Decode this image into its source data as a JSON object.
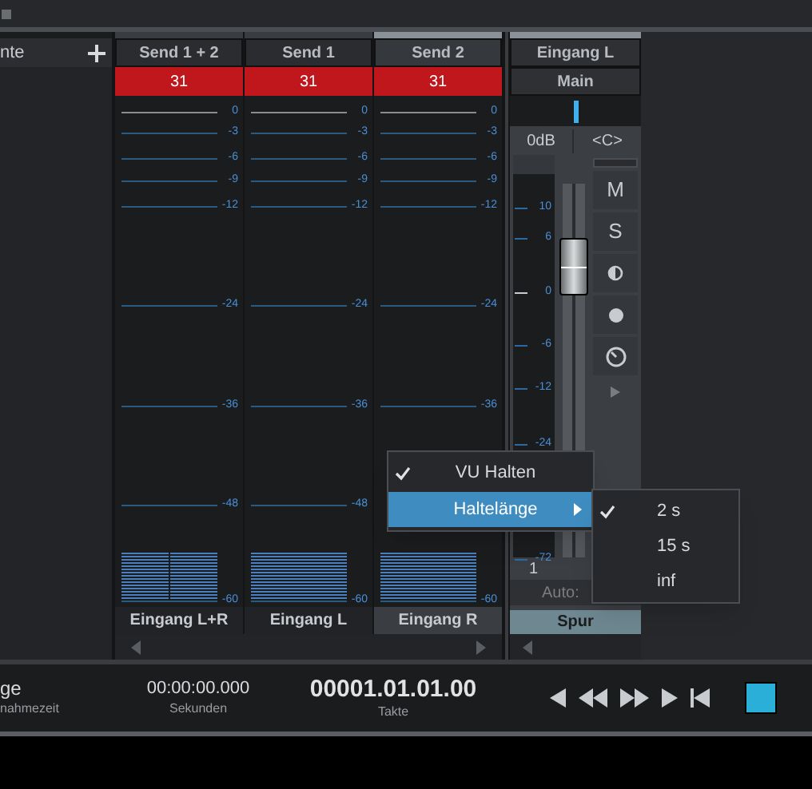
{
  "sidebar": {
    "title": "nte"
  },
  "sends": [
    {
      "name": "Send 1 + 2",
      "value": "31",
      "selected": false,
      "kind": "stereo",
      "scale": [
        "0",
        "-3",
        "-6",
        "-9",
        "-12",
        "-24",
        "-36",
        "-48",
        "-60"
      ],
      "footer": "Eingang L+R"
    },
    {
      "name": "Send 1",
      "value": "31",
      "selected": false,
      "kind": "mono",
      "scale": [
        "0",
        "-3",
        "-6",
        "-9",
        "-12",
        "-24",
        "-36",
        "-48",
        "-60"
      ],
      "footer": "Eingang L"
    },
    {
      "name": "Send 2",
      "value": "31",
      "selected": true,
      "kind": "mono",
      "scale": [
        "0",
        "-3",
        "-6",
        "-9",
        "-12",
        "-24",
        "-36",
        "-60"
      ],
      "footer": "Eingang R"
    }
  ],
  "channel": {
    "name": "Eingang L",
    "output": "Main",
    "volume": "0dB",
    "pan": "<C>",
    "scale": [
      "10",
      "6",
      "0",
      "-6",
      "-12",
      "-24",
      "-72"
    ],
    "buttons": [
      "M",
      "S"
    ],
    "number": "1",
    "automation": "Auto:",
    "footer": "Spur"
  },
  "context_menu": {
    "items": [
      {
        "label": "VU Halten",
        "checked": true,
        "selected": false,
        "submenu": false
      },
      {
        "label": "Haltelänge",
        "checked": false,
        "selected": true,
        "submenu": true
      }
    ]
  },
  "submenu": {
    "items": [
      {
        "label": "2 s",
        "checked": true
      },
      {
        "label": "15 s",
        "checked": false
      },
      {
        "label": "inf",
        "checked": false
      }
    ]
  },
  "transport": {
    "record_time": {
      "value": "ge",
      "label": "nahmezeit"
    },
    "seconds": {
      "value": "00:00:00.000",
      "label": "Sekunden"
    },
    "bars": {
      "value": "00001.01.01.00",
      "label": "Takte"
    }
  }
}
